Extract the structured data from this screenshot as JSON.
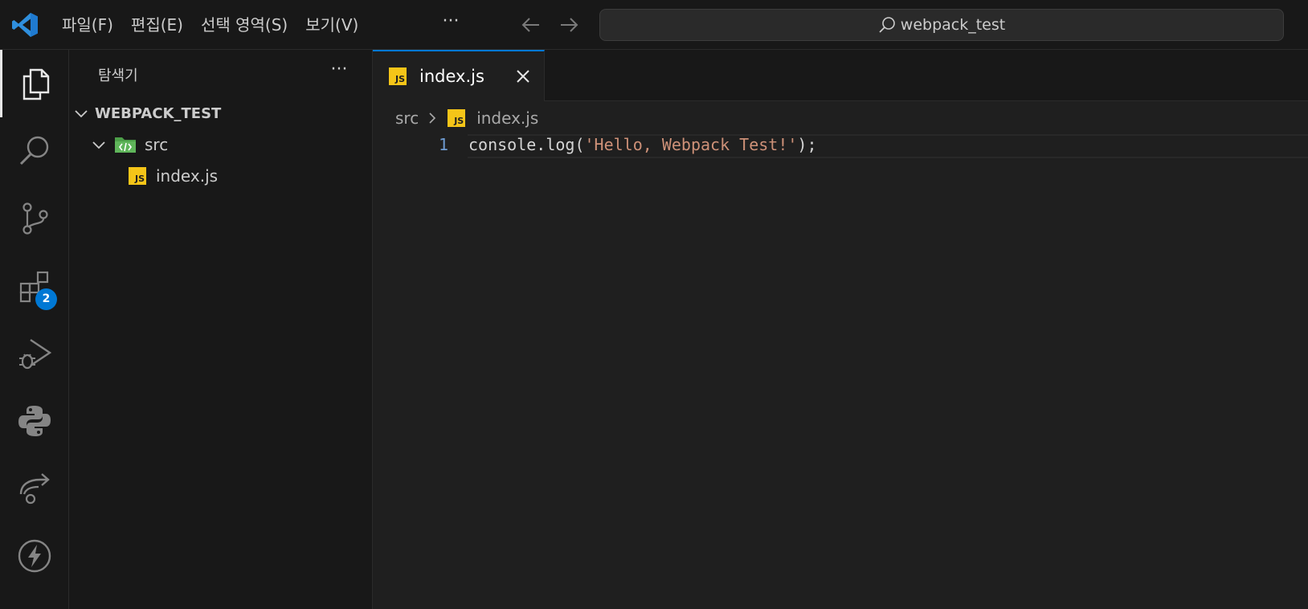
{
  "menu": {
    "file": "파일(F)",
    "edit": "편집(E)",
    "selection": "선택 영역(S)",
    "view": "보기(V)",
    "more": "···"
  },
  "search": {
    "text": "webpack_test"
  },
  "activity_bar": {
    "items": [
      "explorer-icon",
      "search-icon",
      "source-control-icon",
      "extensions-icon",
      "run-debug-icon",
      "python-icon",
      "remote-explorer-icon",
      "thunder-client-icon"
    ],
    "extensions_badge": "2"
  },
  "sidebar": {
    "title": "탐색기",
    "more": "···",
    "tree": {
      "root": "WEBPACK_TEST",
      "folder": "src",
      "file": "index.js"
    }
  },
  "editor": {
    "tab_label": "index.js",
    "js_badge": "JS",
    "breadcrumb": {
      "folder": "src",
      "file": "index.js"
    },
    "lines": [
      {
        "number": "1",
        "prefix": "console.log(",
        "string": "'Hello, Webpack Test!'",
        "suffix": ");"
      }
    ]
  },
  "colors": {
    "accent": "#0078d4",
    "badge": "#0078d4",
    "js_icon": "#f5c518",
    "string": "#ce9178",
    "line_number": "#6e9bd1",
    "background": "#1f1f1f",
    "chrome": "#181818"
  }
}
